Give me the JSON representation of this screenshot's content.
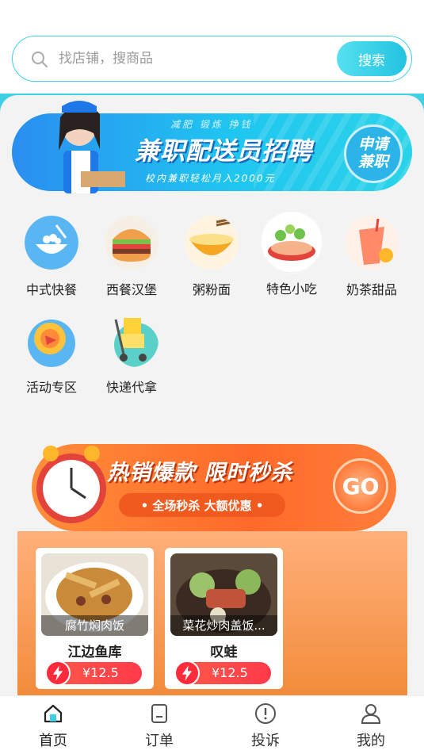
{
  "search": {
    "placeholder": "找店铺，搜商品",
    "button_label": "搜索"
  },
  "banner": {
    "subtitle": "减肥  锻炼  挣钱",
    "title": "兼职配送员招聘",
    "description": "校内兼职轻松月入2000元",
    "badge": "申请兼职"
  },
  "categories": [
    {
      "label": "中式快餐",
      "icon": "rice-bowl-icon"
    },
    {
      "label": "西餐汉堡",
      "icon": "burger-icon"
    },
    {
      "label": "粥粉面",
      "icon": "noodle-bowl-icon"
    },
    {
      "label": "特色小吃",
      "icon": "snack-plate-icon"
    },
    {
      "label": "奶茶甜品",
      "icon": "milk-tea-icon"
    },
    {
      "label": "活动专区",
      "icon": "event-icon"
    },
    {
      "label": "快递代拿",
      "icon": "delivery-cart-icon"
    }
  ],
  "flash_sale": {
    "title": "热销爆款 限时秒杀",
    "tagline": "• 全场秒杀 大额优惠 •",
    "go_label": "GO"
  },
  "products": [
    {
      "name": "腐竹焖肉饭",
      "shop": "江边鱼库",
      "price": "¥12.5"
    },
    {
      "name": "菜花炒肉盖饭...",
      "shop": "叹蛙",
      "price": "¥12.5"
    }
  ],
  "tabs": [
    {
      "label": "首页",
      "icon": "home-icon",
      "active": true
    },
    {
      "label": "订单",
      "icon": "order-icon",
      "active": false
    },
    {
      "label": "投诉",
      "icon": "complaint-icon",
      "active": false
    },
    {
      "label": "我的",
      "icon": "profile-icon",
      "active": false
    }
  ],
  "colors": {
    "accent": "#3fd0e6",
    "flash": "#ff6a2a",
    "price": "#ff3a4a"
  }
}
